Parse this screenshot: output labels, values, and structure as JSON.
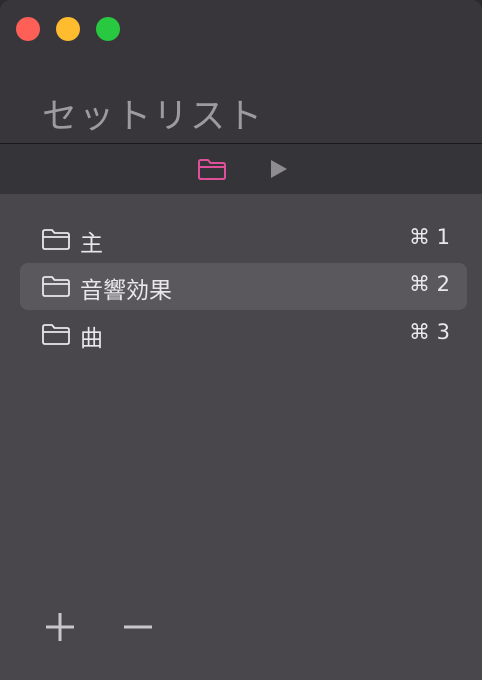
{
  "window": {
    "title": "セットリスト"
  },
  "toolbar": {
    "folder_icon": "folder-icon",
    "play_icon": "play-icon",
    "accent": "#e0509a"
  },
  "setlist": {
    "items": [
      {
        "label": "主",
        "shortcut": "⌘ 1",
        "selected": false
      },
      {
        "label": "音響効果",
        "shortcut": "⌘ 2",
        "selected": true
      },
      {
        "label": "曲",
        "shortcut": "⌘ 3",
        "selected": false
      }
    ]
  },
  "footer": {
    "add_icon": "plus-icon",
    "remove_icon": "minus-icon"
  }
}
